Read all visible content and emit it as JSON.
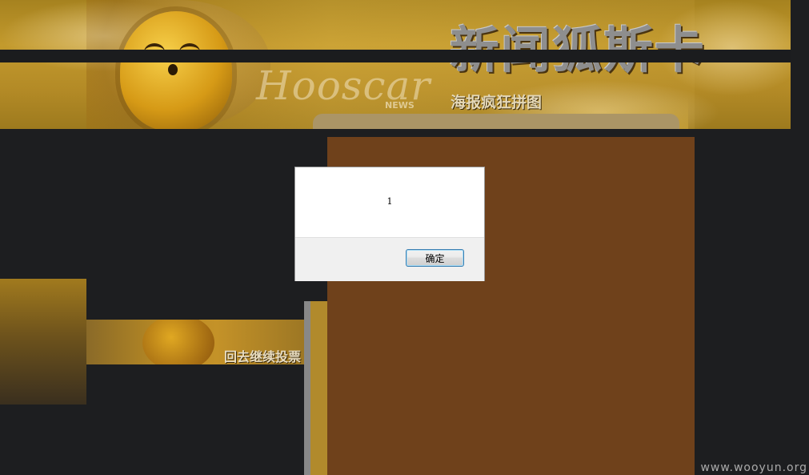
{
  "header": {
    "title": "新闻狐斯卡",
    "subtitle": "海报疯狂拼图",
    "logo_text": "Hooscar",
    "logo_sub": "NEWS"
  },
  "sidebar": {
    "back_vote_label": "回去继续投票"
  },
  "dialog": {
    "message": "1",
    "ok_label": "确定"
  },
  "watermark": "www.wooyun.org",
  "colors": {
    "overlay_bg": "#1d1e20",
    "brown_panel": "#6f411b",
    "header_gold": "#c39a2d",
    "dialog_button_border": "#3c7fb1"
  },
  "icons": {
    "mascot": "mascot-icon"
  }
}
